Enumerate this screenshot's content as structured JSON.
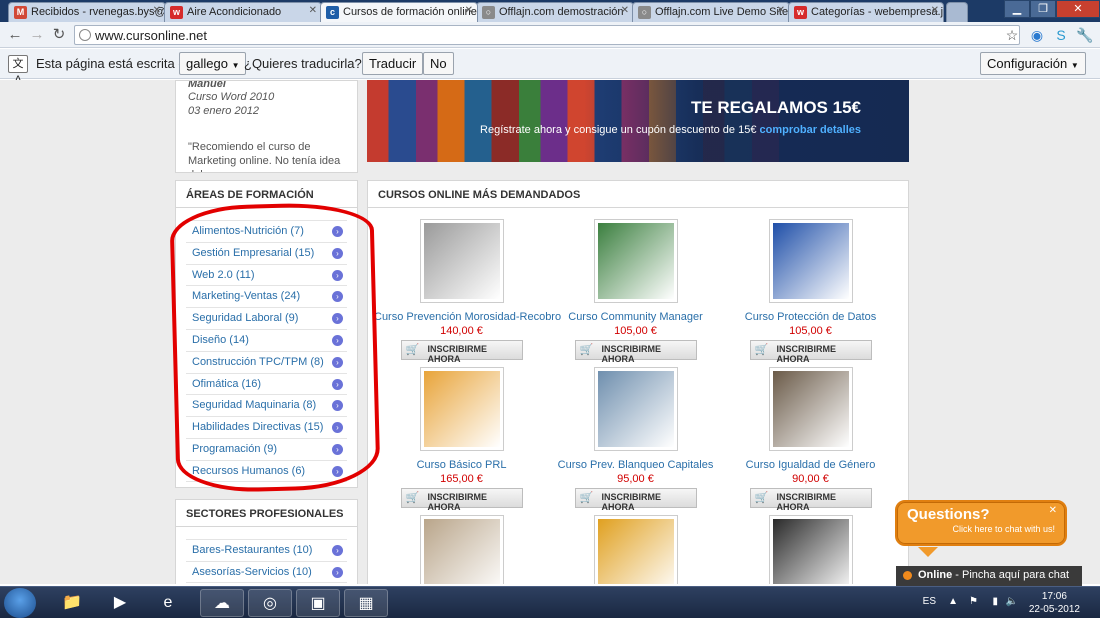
{
  "browser": {
    "tabs": [
      {
        "title": "Recibidos - rvenegas.bys@g",
        "icon": "gmail-icon",
        "color": "#d14836",
        "glyph": "M"
      },
      {
        "title": "Aire Acondicionado",
        "icon": "webempresa-icon",
        "color": "#d62b2b",
        "glyph": "w"
      },
      {
        "title": "Cursos de formación online",
        "icon": "cursonline-icon",
        "color": "#1f5ea8",
        "glyph": "c"
      },
      {
        "title": "Offlajn.com demostración",
        "icon": "offlajn-icon",
        "color": "#8a8a8a",
        "glyph": "○"
      },
      {
        "title": "Offlajn.com Live Demo Site",
        "icon": "offlajn-icon",
        "color": "#8a8a8a",
        "glyph": "○"
      },
      {
        "title": "Categorías - webempresa.jc",
        "icon": "webempresa-icon",
        "color": "#d62b2b",
        "glyph": "w"
      }
    ],
    "url": "www.cursonline.net"
  },
  "translate_bar": {
    "prefix": "Esta página está escrita en",
    "language": "gallego",
    "question": "¿Quieres traducirla?",
    "translate_button": "Traducir",
    "no_button": "No",
    "settings_button": "Configuración"
  },
  "testimonial": {
    "name": "Manuel",
    "course": "Curso Word 2010",
    "date": "03 enero 2012",
    "quote_line1": "\"Recomiendo el curso de",
    "quote_line2": "Marketing online. No tenía idea del"
  },
  "banner": {
    "title": "TE REGALAMOS 15€",
    "subtitle": "Regístrate ahora y consigue un cupón descuento de 15€",
    "link": "comprobar detalles"
  },
  "areas": {
    "title": "ÁREAS DE FORMACIÓN",
    "items": [
      "Alimentos-Nutrición (7)",
      "Gestión Empresarial (15)",
      "Web 2.0 (11)",
      "Marketing-Ventas (24)",
      "Seguridad Laboral (9)",
      "Diseño (14)",
      "Construcción TPC/TPM (8)",
      "Ofimática (16)",
      "Seguridad Maquinaria (8)",
      "Habilidades Directivas (15)",
      "Programación (9)",
      "Recursos Humanos (6)"
    ]
  },
  "sectores": {
    "title": "SECTORES PROFESIONALES",
    "items": [
      "Bares-Restaurantes (10)",
      "Asesorías-Servicios (10)"
    ]
  },
  "courses": {
    "title": "CURSOS ONLINE MÁS DEMANDADOS",
    "buy_label": "INSCRIBIRME AHORA",
    "items": [
      {
        "name": "Curso Prevención Morosidad-Recobro",
        "price": "140,00 €",
        "thumb": "#9a9a9a"
      },
      {
        "name": "Curso Community Manager",
        "price": "105,00 €",
        "thumb": "#3b7f3f"
      },
      {
        "name": "Curso Protección de Datos",
        "price": "105,00 €",
        "thumb": "#1f4fa8"
      },
      {
        "name": "Curso Básico PRL",
        "price": "165,00 €",
        "thumb": "#e8a43a"
      },
      {
        "name": "Curso Prev. Blanqueo Capitales",
        "price": "95,00 €",
        "thumb": "#6f8fae"
      },
      {
        "name": "Curso Igualdad de Género",
        "price": "90,00 €",
        "thumb": "#6a5a48"
      },
      {
        "name": "",
        "price": "",
        "thumb": "#b9a58a"
      },
      {
        "name": "",
        "price": "",
        "thumb": "#e0a020"
      },
      {
        "name": "",
        "price": "",
        "thumb": "#2a2a2a"
      }
    ]
  },
  "chat": {
    "bubble_title": "Questions?",
    "bubble_sub": "Click here to chat with us!",
    "online_label": "Online",
    "online_text": " - Pincha aquí para chat"
  },
  "taskbar": {
    "language": "ES",
    "time": "17:06",
    "date": "22-05-2012"
  }
}
